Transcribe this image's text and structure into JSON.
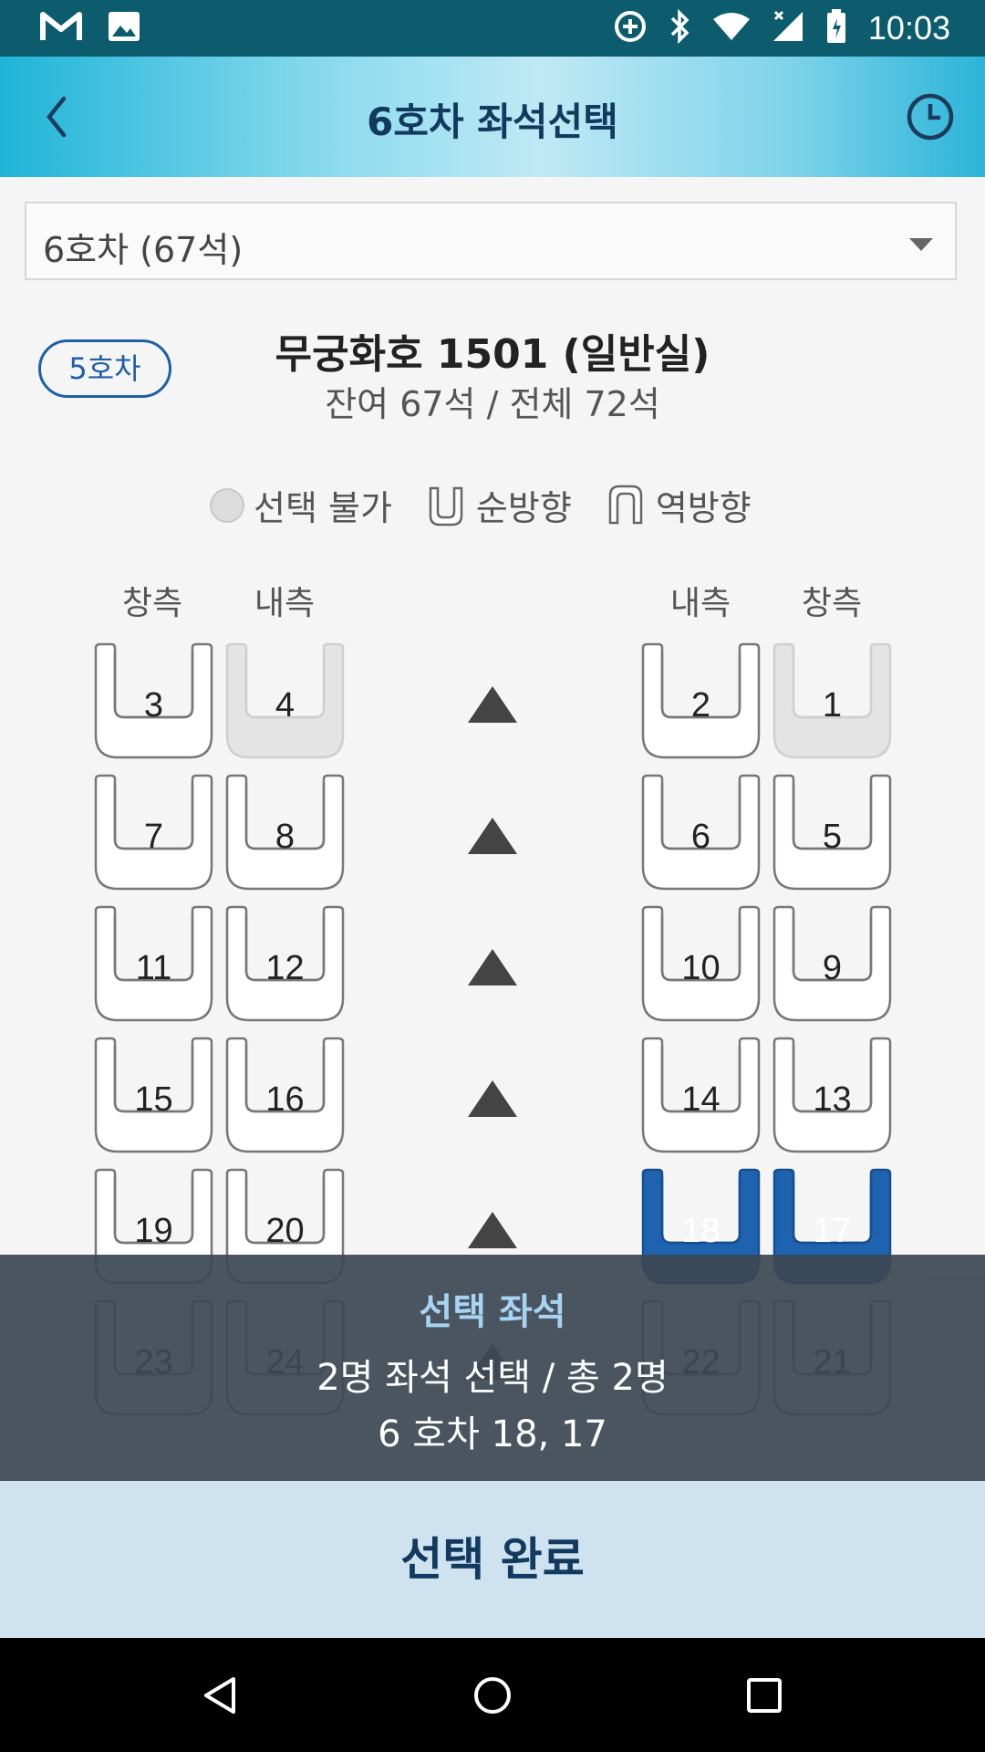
{
  "status_bar": {
    "time": "10:03",
    "icons": [
      "gmail-icon",
      "image-icon",
      "data-saver-icon",
      "bluetooth-icon",
      "wifi-icon",
      "signal-icon",
      "battery-icon"
    ]
  },
  "header": {
    "title": "6호차 좌석선택",
    "back_icon": "chevron-left-icon",
    "history_icon": "clock-icon"
  },
  "car_select": {
    "value": "6호차 (67석)"
  },
  "train_info": {
    "prev_car": "5호차",
    "name": "무궁화호 1501 (일반실)",
    "remaining": "잔여 67석 / 전체 72석"
  },
  "legend": {
    "unavailable": "선택 불가",
    "forward": "순방향",
    "backward": "역방향"
  },
  "columns": {
    "left_window": "창측",
    "left_aisle": "내측",
    "right_aisle": "내측",
    "right_window": "창측"
  },
  "seats": {
    "rows": [
      {
        "l_window": {
          "num": "3",
          "state": "available"
        },
        "l_aisle": {
          "num": "4",
          "state": "unavailable"
        },
        "r_aisle": {
          "num": "2",
          "state": "available"
        },
        "r_window": {
          "num": "1",
          "state": "unavailable"
        }
      },
      {
        "l_window": {
          "num": "7",
          "state": "available"
        },
        "l_aisle": {
          "num": "8",
          "state": "available"
        },
        "r_aisle": {
          "num": "6",
          "state": "available"
        },
        "r_window": {
          "num": "5",
          "state": "available"
        }
      },
      {
        "l_window": {
          "num": "11",
          "state": "available"
        },
        "l_aisle": {
          "num": "12",
          "state": "available"
        },
        "r_aisle": {
          "num": "10",
          "state": "available"
        },
        "r_window": {
          "num": "9",
          "state": "available"
        }
      },
      {
        "l_window": {
          "num": "15",
          "state": "available"
        },
        "l_aisle": {
          "num": "16",
          "state": "available"
        },
        "r_aisle": {
          "num": "14",
          "state": "available"
        },
        "r_window": {
          "num": "13",
          "state": "available"
        }
      },
      {
        "l_window": {
          "num": "19",
          "state": "available"
        },
        "l_aisle": {
          "num": "20",
          "state": "available"
        },
        "r_aisle": {
          "num": "18",
          "state": "selected"
        },
        "r_window": {
          "num": "17",
          "state": "selected"
        }
      },
      {
        "l_window": {
          "num": "23",
          "state": "available"
        },
        "l_aisle": {
          "num": "24",
          "state": "available"
        },
        "r_aisle": {
          "num": "22",
          "state": "available"
        },
        "r_window": {
          "num": "21",
          "state": "available"
        }
      }
    ]
  },
  "selection": {
    "title": "선택 좌석",
    "summary": "2명 좌석 선택 / 총 2명",
    "detail": "6 호차 18, 17"
  },
  "complete_button": "선택 완료",
  "nav_bar": [
    "back-triangle-icon",
    "home-circle-icon",
    "recents-square-icon"
  ],
  "colors": {
    "selected_seat": "#1e63b0",
    "header_title": "#113a5e",
    "overlay": "#3c4854",
    "complete_bg": "#cfe2f0"
  }
}
